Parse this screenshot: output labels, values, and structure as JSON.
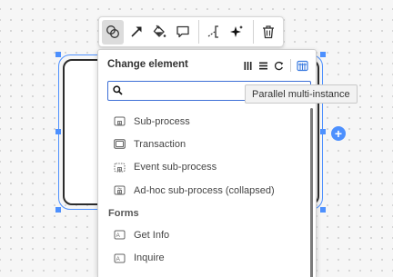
{
  "canvas": {
    "append_symbol": "+"
  },
  "context_pad": {
    "tools": [
      {
        "icon": "change-type-icon",
        "active": true
      },
      {
        "icon": "connect-arrow-icon"
      },
      {
        "icon": "color-bucket-icon"
      },
      {
        "icon": "comment-icon"
      },
      {
        "icon": "text-annotation-icon"
      },
      {
        "icon": "ai-sparkle-icon"
      },
      {
        "icon": "trash-icon"
      }
    ]
  },
  "popup": {
    "title": "Change element",
    "header_icons": [
      "parallel-multi-instance-icon",
      "sequential-multi-instance-icon",
      "loop-icon",
      "ad-hoc-icon"
    ],
    "search": {
      "placeholder": "",
      "value": ""
    },
    "items": [
      {
        "label": "Sub-process",
        "icon": "collapsed-subprocess-icon"
      },
      {
        "label": "Transaction",
        "icon": "transaction-icon"
      },
      {
        "label": "Event sub-process",
        "icon": "event-subprocess-icon"
      },
      {
        "label": "Ad-hoc sub-process (collapsed)",
        "icon": "adhoc-subprocess-icon"
      }
    ],
    "forms_group": {
      "label": "Forms",
      "items": [
        {
          "label": "Get Info",
          "icon": "form-icon"
        },
        {
          "label": "Inquire",
          "icon": "form-icon"
        }
      ]
    }
  },
  "tooltip": {
    "text": "Parallel multi-instance"
  },
  "colors": {
    "selection": "#4d90fe",
    "search_focus": "#3d6fd6",
    "active_tool_bg": "#dcdcdc"
  }
}
